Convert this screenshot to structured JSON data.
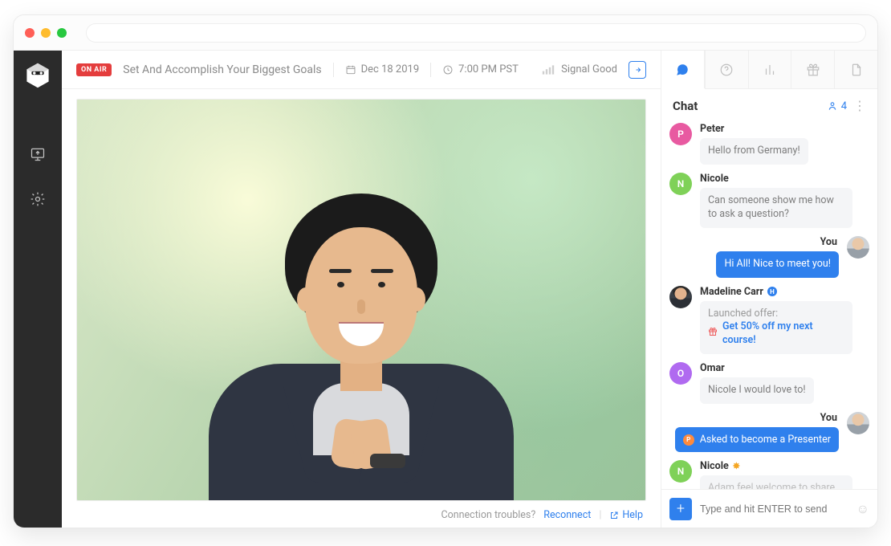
{
  "header": {
    "on_air": "ON AIR",
    "title": "Set And Accomplish Your Biggest Goals",
    "date": "Dec 18 2019",
    "time": "7:00 PM PST",
    "signal": "Signal Good"
  },
  "footer": {
    "troubles": "Connection troubles?",
    "reconnect": "Reconnect",
    "help": "Help"
  },
  "side": {
    "tabs": [
      "chat",
      "help",
      "polls",
      "offers",
      "handouts"
    ],
    "chat_title": "Chat",
    "viewer_count": "4"
  },
  "chat": {
    "you_label": "You",
    "messages": [
      {
        "from": "Peter",
        "initial": "P",
        "avatarClass": "av-p",
        "text": "Hello from Germany!"
      },
      {
        "from": "Nicole",
        "initial": "N",
        "avatarClass": "av-n",
        "text": "Can someone show me how to ask a question?"
      }
    ],
    "you1": "Hi All! Nice to meet you!",
    "host": {
      "name": "Madeline Carr",
      "line1": "Launched offer:",
      "line2": "Get 50% off my next course!"
    },
    "omar": {
      "name": "Omar",
      "initial": "O",
      "text": "Nicole I would love to!"
    },
    "you2": "Asked to become a Presenter",
    "nicole2": {
      "name": "Nicole",
      "initial": "N",
      "text": "Adam feel welcome to share your"
    }
  },
  "compose": {
    "placeholder": "Type and hit ENTER to send"
  }
}
